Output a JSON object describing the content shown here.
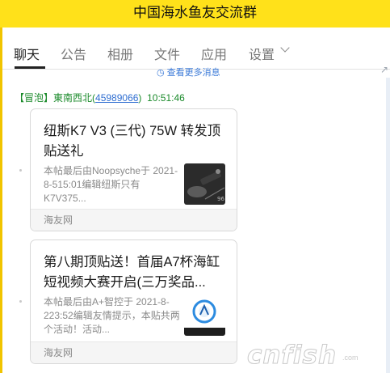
{
  "window": {
    "title": "中国海水鱼友交流群"
  },
  "tabs": [
    {
      "label": "聊天",
      "active": true
    },
    {
      "label": "公告"
    },
    {
      "label": "相册"
    },
    {
      "label": "文件"
    },
    {
      "label": "应用"
    },
    {
      "label": "设置"
    }
  ],
  "history": {
    "more_label": "查看更多消息"
  },
  "message": {
    "badge": "【冒泡】",
    "sender": "東南西北",
    "sender_id": "45989066",
    "time": "10:51:46"
  },
  "cards": [
    {
      "title": "纽斯K7 V3 (三代) 75W 转发顶贴送礼",
      "desc": "本帖最后由Noopsyche于 2021-8-515:01编辑纽斯只有K7V375...",
      "source": "海友网",
      "thumb_icon": "product-photo-icon"
    },
    {
      "title": "第八期顶贴送！首届A7杯海缸短视频大赛开启(三万奖品...",
      "desc": "本帖最后由A+智控于 2021-8-223:52编辑友情提示，本贴共两个活动！活动...",
      "source": "海友网",
      "thumb_icon": "a7-logo-icon"
    }
  ],
  "watermark": {
    "text": "cnfish",
    "sub": ".com"
  },
  "colors": {
    "title_bar": "#ffe11a",
    "sender_green": "#1a8a2a",
    "link_blue": "#2f6ed1"
  }
}
